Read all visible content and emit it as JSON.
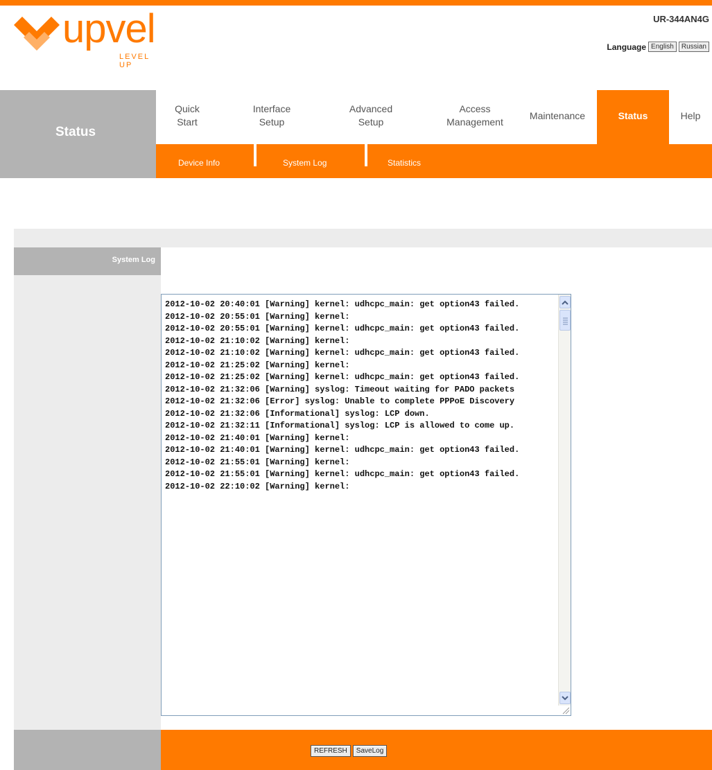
{
  "brand": {
    "name": "upvel",
    "tagline": "LEVEL UP",
    "logo_icon": "upvel-chevron-logo",
    "accent": "#ff7a00"
  },
  "model": "UR-344AN4G",
  "language": {
    "label": "Language",
    "english": "English",
    "russian": "Russian"
  },
  "page_title": "Status",
  "nav": {
    "quick_start": [
      "Quick",
      "Start"
    ],
    "interface_setup": [
      "Interface",
      "Setup"
    ],
    "advanced_setup": [
      "Advanced",
      "Setup"
    ],
    "access_management": [
      "Access",
      "Management"
    ],
    "maintenance": "Maintenance",
    "status": "Status",
    "help": "Help"
  },
  "submenu": {
    "device_info": "Device Info",
    "system_log": "System Log",
    "statistics": "Statistics"
  },
  "section_label": "System Log",
  "log_text": "2012-10-02 20:40:01 [Warning] kernel: udhcpc_main: get option43 failed.\n2012-10-02 20:55:01 [Warning] kernel:\n2012-10-02 20:55:01 [Warning] kernel: udhcpc_main: get option43 failed.\n2012-10-02 21:10:02 [Warning] kernel:\n2012-10-02 21:10:02 [Warning] kernel: udhcpc_main: get option43 failed.\n2012-10-02 21:25:02 [Warning] kernel:\n2012-10-02 21:25:02 [Warning] kernel: udhcpc_main: get option43 failed.\n2012-10-02 21:32:06 [Warning] syslog: Timeout waiting for PADO packets\n2012-10-02 21:32:06 [Error] syslog: Unable to complete PPPoE Discovery\n2012-10-02 21:32:06 [Informational] syslog: LCP down.\n2012-10-02 21:32:11 [Informational] syslog: LCP is allowed to come up.\n2012-10-02 21:40:01 [Warning] kernel:\n2012-10-02 21:40:01 [Warning] kernel: udhcpc_main: get option43 failed.\n2012-10-02 21:55:01 [Warning] kernel:\n2012-10-02 21:55:01 [Warning] kernel: udhcpc_main: get option43 failed.\n2012-10-02 22:10:02 [Warning] kernel:",
  "buttons": {
    "refresh": "REFRESH",
    "save_log": "SaveLog"
  }
}
